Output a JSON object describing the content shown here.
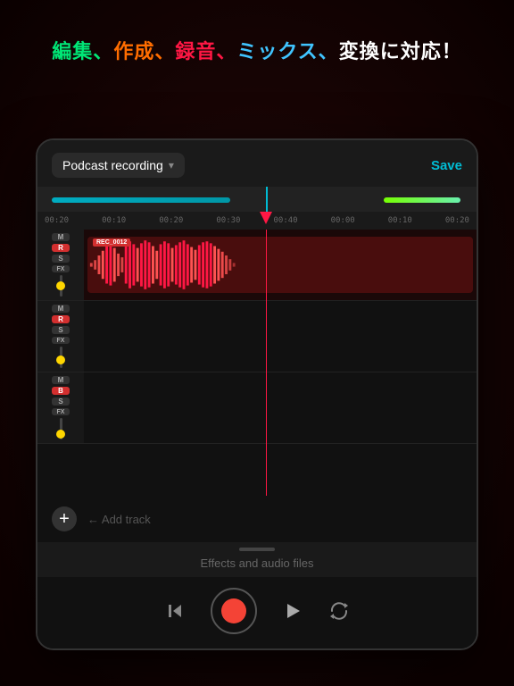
{
  "tagline": {
    "part1": "編集、",
    "part2": "作成、",
    "part3": "録音、",
    "part4": "ミックス、",
    "part5": "変換に対応！"
  },
  "app": {
    "project_name": "Podcast recording",
    "save_label": "Save",
    "add_track_label": "← Add track",
    "bottom_panel_label": "Effects and audio files",
    "waveform_clip_label": "REC_0012",
    "time_labels": [
      "00:20",
      "00:10",
      "00:20",
      "00:30",
      "00:40",
      "00:00",
      "00:10",
      "00:20"
    ],
    "tracks": [
      {
        "id": "track-1",
        "m": "M",
        "r": "R",
        "s": "S",
        "fx": "FX",
        "has_waveform": true
      },
      {
        "id": "track-2",
        "m": "M",
        "r": "R",
        "s": "S",
        "fx": "FX",
        "has_waveform": false
      },
      {
        "id": "track-3",
        "m": "M",
        "r": "B",
        "s": "S",
        "fx": "FX",
        "has_waveform": false
      }
    ]
  },
  "transport": {
    "rewind_label": "⏮",
    "record_label": "●",
    "play_label": "▶",
    "loop_label": "🔁"
  }
}
